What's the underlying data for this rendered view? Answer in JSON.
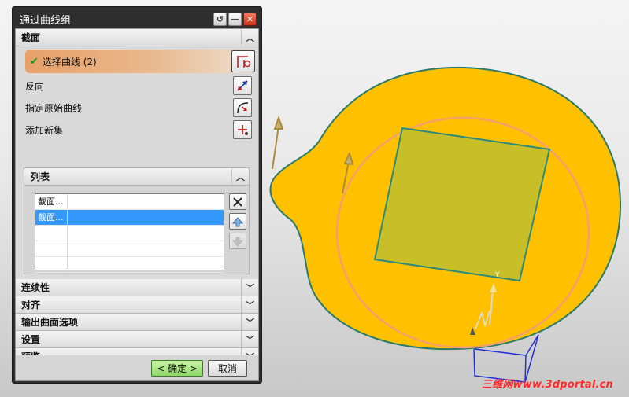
{
  "dialog": {
    "title": "通过曲线组",
    "sections": {
      "section": {
        "header": "截面",
        "select_curve_label": "选择曲线 (2)",
        "reverse_label": "反向",
        "specify_origin_label": "指定原始曲线",
        "add_new_set_label": "添加新集"
      },
      "list": {
        "header": "列表",
        "rows": [
          {
            "name": "截面...",
            "selected": false
          },
          {
            "name": "截面...",
            "selected": true
          },
          {
            "name": "",
            "selected": false
          },
          {
            "name": "",
            "selected": false
          },
          {
            "name": "",
            "selected": false
          }
        ]
      },
      "collapsed": [
        {
          "label": "连续性"
        },
        {
          "label": "对齐"
        },
        {
          "label": "输出曲面选项"
        },
        {
          "label": "设置"
        },
        {
          "label": "预览"
        }
      ]
    },
    "buttons": {
      "ok": "< 确定 >",
      "cancel": "取消"
    }
  },
  "viewport": {
    "axis_label": "Y",
    "watermark": "三维网www.3dportal.cn",
    "colors": {
      "surface": "#ffc000",
      "square": "#c8be28",
      "circle": "#f0a070",
      "edge": "#2b8a7a"
    }
  }
}
